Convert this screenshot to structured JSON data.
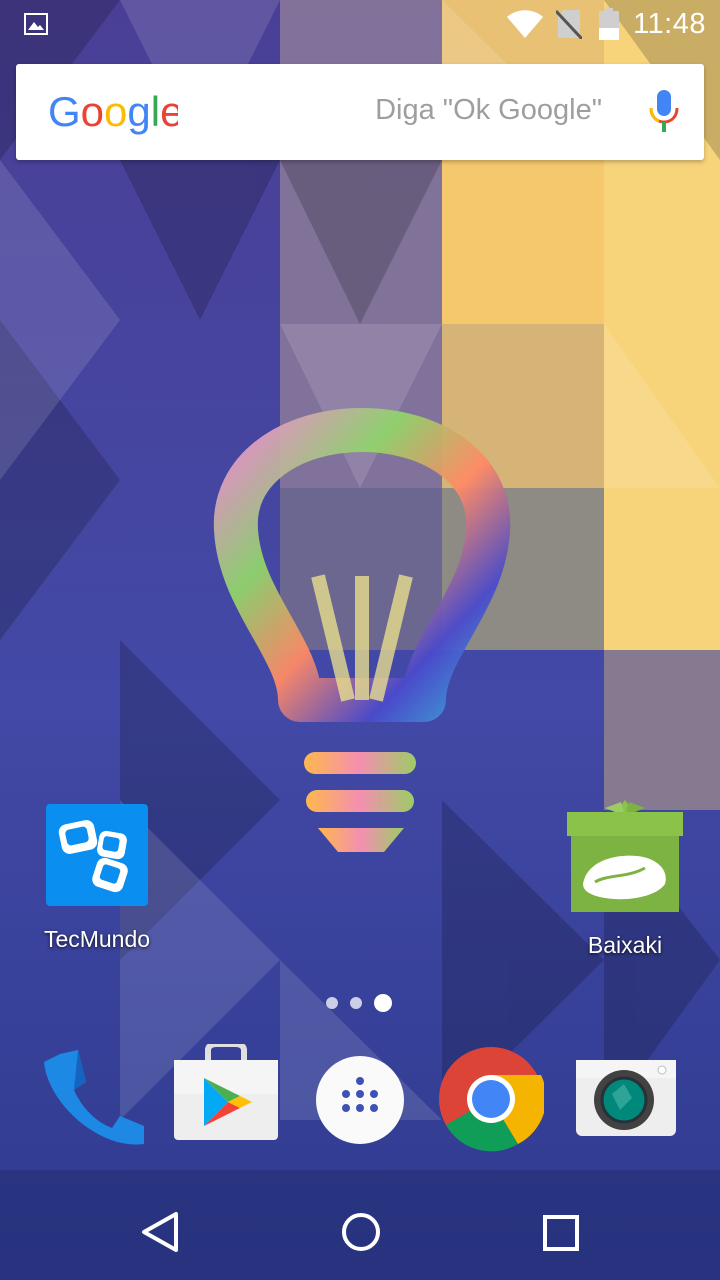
{
  "status_bar": {
    "time": "11:48",
    "icons": [
      "image-notification-icon",
      "wifi-icon",
      "no-sim-icon",
      "battery-icon"
    ]
  },
  "search": {
    "logo_text": "Google",
    "hint": "Diga \"Ok Google\""
  },
  "wallpaper": {
    "description_icon": "lightbulb-icon",
    "colors": {
      "purple": "#4b3f9e",
      "yellow": "#f2c869",
      "blue": "#3b4fa8"
    }
  },
  "desktop_apps": [
    {
      "label": "TecMundo",
      "icon": "tecmundo-icon"
    },
    {
      "label": "Baixaki",
      "icon": "baixaki-icon"
    }
  ],
  "page_indicator": {
    "pages": 3,
    "active": 3
  },
  "dock": [
    {
      "icon": "phone-icon"
    },
    {
      "icon": "play-store-icon"
    },
    {
      "icon": "app-drawer-icon"
    },
    {
      "icon": "chrome-icon"
    },
    {
      "icon": "camera-icon"
    }
  ],
  "nav_bar": [
    "back-icon",
    "home-icon",
    "recents-icon"
  ],
  "colors": {
    "google_blue": "#4285f4",
    "google_red": "#ea4335",
    "google_yellow": "#fbbc05",
    "google_green": "#34a853"
  }
}
